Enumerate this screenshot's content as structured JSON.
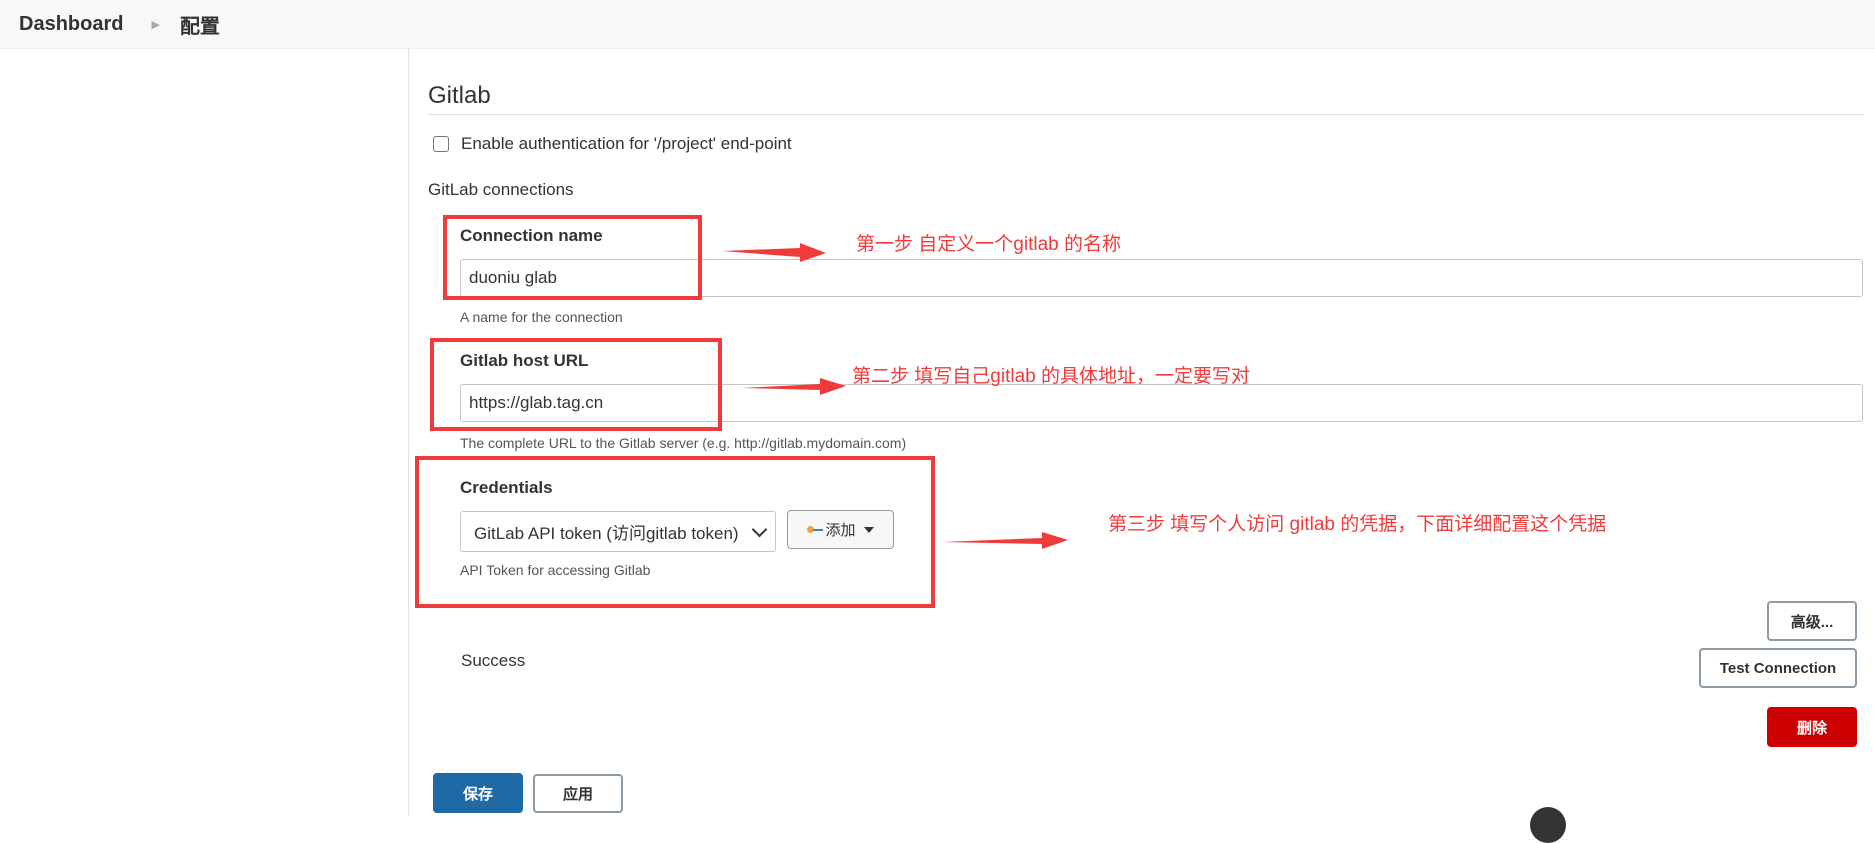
{
  "breadcrumb": {
    "dashboard": "Dashboard",
    "config": "配置"
  },
  "section": {
    "title": "Gitlab"
  },
  "auth_checkbox": {
    "label": "Enable authentication for '/project' end-point",
    "checked": false
  },
  "connections_label": "GitLab connections",
  "connection_name": {
    "label": "Connection name",
    "value": "duoniu glab",
    "help": "A name for the connection"
  },
  "host_url": {
    "label": "Gitlab host URL",
    "value": "https://glab.tag.cn",
    "help": "The complete URL to the Gitlab server (e.g. http://gitlab.mydomain.com)"
  },
  "credentials": {
    "label": "Credentials",
    "selected": "GitLab API token (访问gitlab token)",
    "add_label": "添加",
    "help": "API Token for accessing Gitlab"
  },
  "buttons": {
    "advanced": "高级...",
    "test_connection": "Test Connection",
    "delete": "删除",
    "save": "保存",
    "apply": "应用"
  },
  "status": "Success",
  "annotations": {
    "step1": "第一步 自定义一个gitlab 的名称",
    "step2": "第二步 填写自己gitlab 的具体地址，一定要写对",
    "step3": "第三步 填写个人访问 gitlab 的凭据，下面详细配置这个凭据"
  },
  "colors": {
    "annotation_red": "#ef3b3b",
    "primary": "#1f6aa5",
    "danger": "#cc0000"
  }
}
